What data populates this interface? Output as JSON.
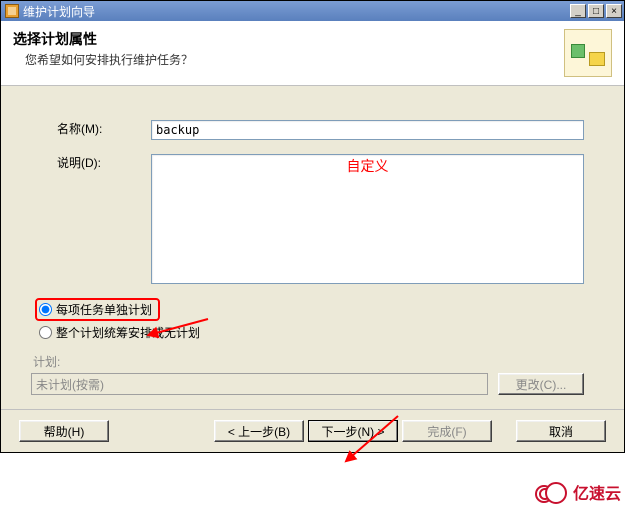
{
  "window": {
    "title": "维护计划向导",
    "buttons": {
      "min": "_",
      "max": "□",
      "close": "×"
    }
  },
  "header": {
    "title": "选择计划属性",
    "subtitle": "您希望如何安排执行维护任务？"
  },
  "form": {
    "name_label": "名称(M):",
    "name_value": "backup",
    "desc_label": "说明(D):",
    "custom_annotation": "自定义"
  },
  "radios": {
    "opt1": "每项任务单独计划",
    "opt2": "整个计划统筹安排或无计划"
  },
  "plan": {
    "group_label": "计划:",
    "value": "未计划(按需)",
    "change_btn": "更改(C)..."
  },
  "footer": {
    "help": "帮助(H)",
    "back": "< 上一步(B)",
    "next": "下一步(N) >",
    "finish": "完成(F)",
    "cancel": "取消"
  },
  "watermark": "亿速云"
}
